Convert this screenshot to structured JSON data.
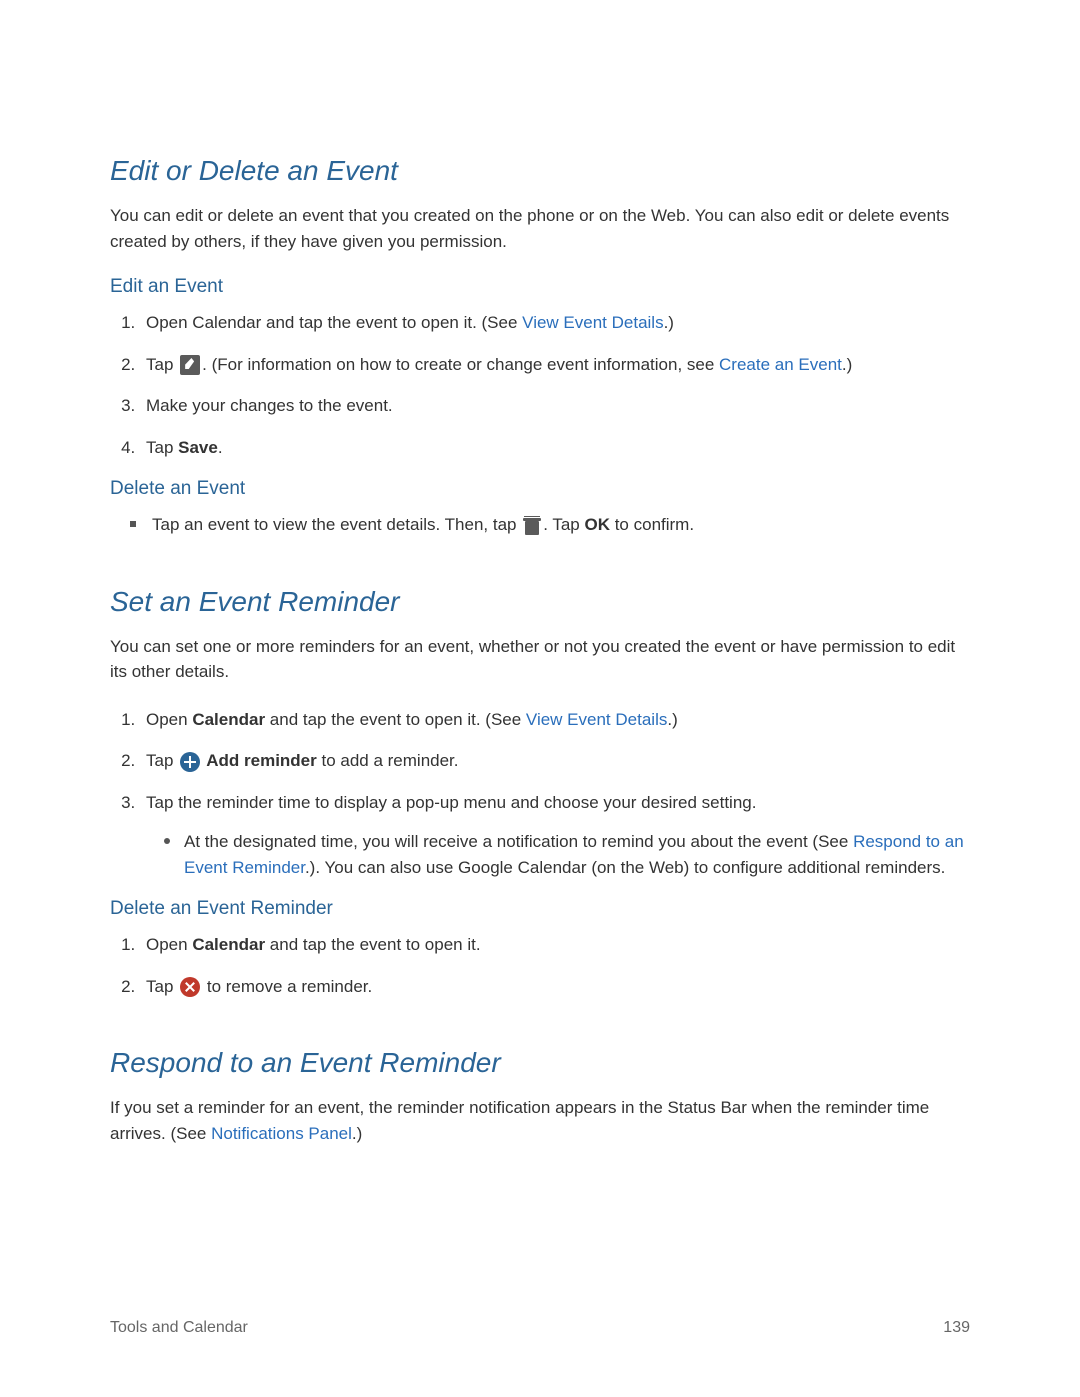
{
  "sections": {
    "editDelete": {
      "title": "Edit or Delete an Event",
      "intro": "You can edit or delete an event that you created on the phone or on the Web. You can also edit or delete events created by others, if they have given you permission.",
      "editSub": "Edit an Event",
      "step1_a": "Open Calendar and tap the event to open it. (See ",
      "step1_link": "View Event Details",
      "step1_b": ".)",
      "step2_a": "Tap ",
      "step2_b": ". (For information on how to create or change event information, see ",
      "step2_link": "Create an Event",
      "step2_c": ".)",
      "step3": "Make your changes to the event.",
      "step4_a": "Tap ",
      "step4_bold": "Save",
      "step4_b": ".",
      "deleteSub": "Delete an Event",
      "bullet_a": "Tap an event to view the event details. Then, tap ",
      "bullet_b": ". Tap ",
      "bullet_bold": "OK",
      "bullet_c": " to confirm."
    },
    "setReminder": {
      "title": "Set an Event Reminder",
      "intro": "You can set one or more reminders for an event, whether or not you created the event or have permission to edit its other details.",
      "step1_a": "Open ",
      "step1_bold": "Calendar",
      "step1_b": " and tap the event to open it. (See ",
      "step1_link": "View Event Details",
      "step1_c": ".)",
      "step2_a": "Tap ",
      "step2_bold": " Add reminder",
      "step2_b": " to add a reminder.",
      "step3": "Tap the reminder time to display a pop-up menu and choose your desired setting.",
      "sub_a": "At the designated time, you will receive a notification to remind you about the event (See ",
      "sub_link": "Respond to an Event Reminder",
      "sub_b": ".). You can also use Google Calendar (on the Web) to configure additional reminders.",
      "deleteSub": "Delete an Event Reminder",
      "d1_a": "Open ",
      "d1_bold": "Calendar",
      "d1_b": " and tap the event to open it.",
      "d2_a": "Tap ",
      "d2_b": " to remove a reminder."
    },
    "respond": {
      "title": "Respond to an Event Reminder",
      "intro_a": "If you set a reminder for an event, the reminder notification appears in the Status Bar when the reminder time arrives. (See ",
      "intro_link": "Notifications Panel",
      "intro_b": ".)"
    }
  },
  "footer": {
    "left": "Tools and Calendar",
    "right": "139"
  }
}
